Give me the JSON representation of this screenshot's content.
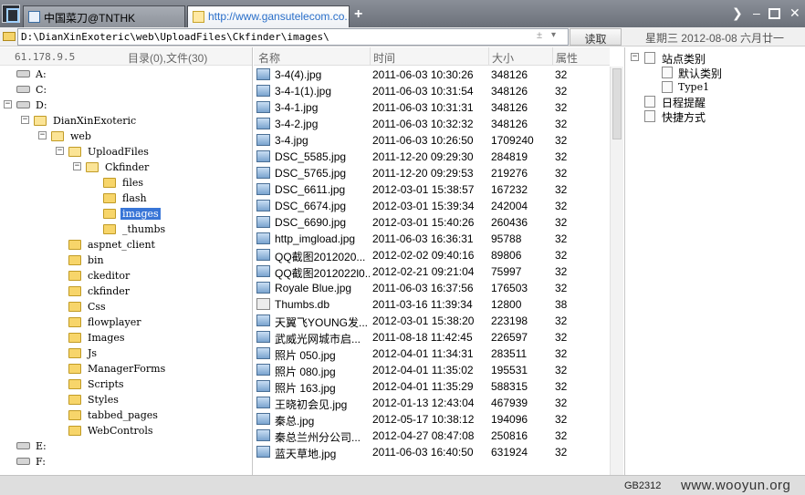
{
  "tabs": [
    {
      "title": "中国菜刀@TNTHK",
      "active": false
    },
    {
      "title": "http://www.gansutelecom.co...",
      "active": true
    }
  ],
  "new_tab_label": "+",
  "path": {
    "value": "D:\\DianXinExoteric\\web\\UploadFiles\\Ckfinder\\images\\",
    "spinner": "±",
    "dropdown": "▾",
    "read_button": "读取"
  },
  "date_display": "星期三 2012-08-08 六月廿一",
  "left_pane": {
    "ip": "61.178.9.5",
    "counts": "目录(0),文件(30)",
    "tree": [
      {
        "label": "A:",
        "type": "drive",
        "depth": 0,
        "toggle": ""
      },
      {
        "label": "C:",
        "type": "drive",
        "depth": 0,
        "toggle": ""
      },
      {
        "label": "D:",
        "type": "drive",
        "depth": 0,
        "toggle": "−"
      },
      {
        "label": "DianXinExoteric",
        "type": "folder",
        "depth": 1,
        "toggle": "−"
      },
      {
        "label": "web",
        "type": "folder",
        "depth": 2,
        "toggle": "−"
      },
      {
        "label": "UploadFiles",
        "type": "folder",
        "depth": 3,
        "toggle": "−"
      },
      {
        "label": "Ckfinder",
        "type": "folder",
        "depth": 4,
        "toggle": "−"
      },
      {
        "label": "files",
        "type": "folder",
        "depth": 5,
        "toggle": ""
      },
      {
        "label": "flash",
        "type": "folder",
        "depth": 5,
        "toggle": ""
      },
      {
        "label": "images",
        "type": "folder",
        "depth": 5,
        "toggle": "",
        "selected": true
      },
      {
        "label": "_thumbs",
        "type": "folder",
        "depth": 5,
        "toggle": ""
      },
      {
        "label": "aspnet_client",
        "type": "folder",
        "depth": 3,
        "toggle": ""
      },
      {
        "label": "bin",
        "type": "folder",
        "depth": 3,
        "toggle": ""
      },
      {
        "label": "ckeditor",
        "type": "folder",
        "depth": 3,
        "toggle": ""
      },
      {
        "label": "ckfinder",
        "type": "folder",
        "depth": 3,
        "toggle": ""
      },
      {
        "label": "Css",
        "type": "folder",
        "depth": 3,
        "toggle": ""
      },
      {
        "label": "flowplayer",
        "type": "folder",
        "depth": 3,
        "toggle": ""
      },
      {
        "label": "Images",
        "type": "folder",
        "depth": 3,
        "toggle": ""
      },
      {
        "label": "Js",
        "type": "folder",
        "depth": 3,
        "toggle": ""
      },
      {
        "label": "ManagerForms",
        "type": "folder",
        "depth": 3,
        "toggle": ""
      },
      {
        "label": "Scripts",
        "type": "folder",
        "depth": 3,
        "toggle": ""
      },
      {
        "label": "Styles",
        "type": "folder",
        "depth": 3,
        "toggle": ""
      },
      {
        "label": "tabbed_pages",
        "type": "folder",
        "depth": 3,
        "toggle": ""
      },
      {
        "label": "WebControls",
        "type": "folder",
        "depth": 3,
        "toggle": ""
      },
      {
        "label": "E:",
        "type": "drive",
        "depth": 0,
        "toggle": ""
      },
      {
        "label": "F:",
        "type": "drive",
        "depth": 0,
        "toggle": ""
      }
    ]
  },
  "file_list": {
    "headers": [
      "名称",
      "时间",
      "大小",
      "属性"
    ],
    "rows": [
      {
        "name": "3-4(4).jpg",
        "time": "2011-06-03 10:30:26",
        "size": "348126",
        "attr": "32",
        "icon": "image"
      },
      {
        "name": "3-4-1(1).jpg",
        "time": "2011-06-03 10:31:54",
        "size": "348126",
        "attr": "32",
        "icon": "image"
      },
      {
        "name": "3-4-1.jpg",
        "time": "2011-06-03 10:31:31",
        "size": "348126",
        "attr": "32",
        "icon": "image"
      },
      {
        "name": "3-4-2.jpg",
        "time": "2011-06-03 10:32:32",
        "size": "348126",
        "attr": "32",
        "icon": "image"
      },
      {
        "name": "3-4.jpg",
        "time": "2011-06-03 10:26:50",
        "size": "1709240",
        "attr": "32",
        "icon": "image"
      },
      {
        "name": "DSC_5585.jpg",
        "time": "2011-12-20 09:29:30",
        "size": "284819",
        "attr": "32",
        "icon": "image"
      },
      {
        "name": "DSC_5765.jpg",
        "time": "2011-12-20 09:29:53",
        "size": "219276",
        "attr": "32",
        "icon": "image"
      },
      {
        "name": "DSC_6611.jpg",
        "time": "2012-03-01 15:38:57",
        "size": "167232",
        "attr": "32",
        "icon": "image"
      },
      {
        "name": "DSC_6674.jpg",
        "time": "2012-03-01 15:39:34",
        "size": "242004",
        "attr": "32",
        "icon": "image"
      },
      {
        "name": "DSC_6690.jpg",
        "time": "2012-03-01 15:40:26",
        "size": "260436",
        "attr": "32",
        "icon": "image"
      },
      {
        "name": "http_imgload.jpg",
        "time": "2011-06-03 16:36:31",
        "size": "95788",
        "attr": "32",
        "icon": "image"
      },
      {
        "name": "QQ截图2012020...",
        "time": "2012-02-02 09:40:16",
        "size": "89806",
        "attr": "32",
        "icon": "image"
      },
      {
        "name": "QQ截图2012022l0...",
        "time": "2012-02-21 09:21:04",
        "size": "75997",
        "attr": "32",
        "icon": "image"
      },
      {
        "name": "Royale Blue.jpg",
        "time": "2011-06-03 16:37:56",
        "size": "176503",
        "attr": "32",
        "icon": "image"
      },
      {
        "name": "Thumbs.db",
        "time": "2011-03-16 11:39:34",
        "size": "12800",
        "attr": "38",
        "icon": "db"
      },
      {
        "name": "天翼飞YOUNG发...",
        "time": "2012-03-01 15:38:20",
        "size": "223198",
        "attr": "32",
        "icon": "image"
      },
      {
        "name": "武威光网城市启...",
        "time": "2011-08-18 11:42:45",
        "size": "226597",
        "attr": "32",
        "icon": "image"
      },
      {
        "name": "照片 050.jpg",
        "time": "2012-04-01 11:34:31",
        "size": "283511",
        "attr": "32",
        "icon": "image"
      },
      {
        "name": "照片 080.jpg",
        "time": "2012-04-01 11:35:02",
        "size": "195531",
        "attr": "32",
        "icon": "image"
      },
      {
        "name": "照片 163.jpg",
        "time": "2012-04-01 11:35:29",
        "size": "588315",
        "attr": "32",
        "icon": "image"
      },
      {
        "name": "王晓初会见.jpg",
        "time": "2012-01-13 12:43:04",
        "size": "467939",
        "attr": "32",
        "icon": "image"
      },
      {
        "name": "秦总.jpg",
        "time": "2012-05-17 10:38:12",
        "size": "194096",
        "attr": "32",
        "icon": "image"
      },
      {
        "name": "秦总兰州分公司...",
        "time": "2012-04-27 08:47:08",
        "size": "250816",
        "attr": "32",
        "icon": "image"
      },
      {
        "name": "蓝天草地.jpg",
        "time": "2011-06-03 16:40:50",
        "size": "631924",
        "attr": "32",
        "icon": "image"
      }
    ]
  },
  "right_pane": {
    "items": [
      {
        "label": "站点类别",
        "toggle": "−",
        "small": false
      },
      {
        "label": "默认类别",
        "toggle": "",
        "small": false
      },
      {
        "label": "Type1",
        "toggle": "",
        "small": true
      },
      {
        "label": "日程提醒",
        "toggle": "",
        "small": false
      },
      {
        "label": "快捷方式",
        "toggle": "",
        "small": false
      }
    ]
  },
  "status_bar": {
    "encoding": "GB2312",
    "watermark": "www.wooyun.org"
  },
  "colors": {
    "selection": "#3875d7",
    "tab_active_text": "#2a6fc9",
    "folder": "#f7d56a"
  }
}
